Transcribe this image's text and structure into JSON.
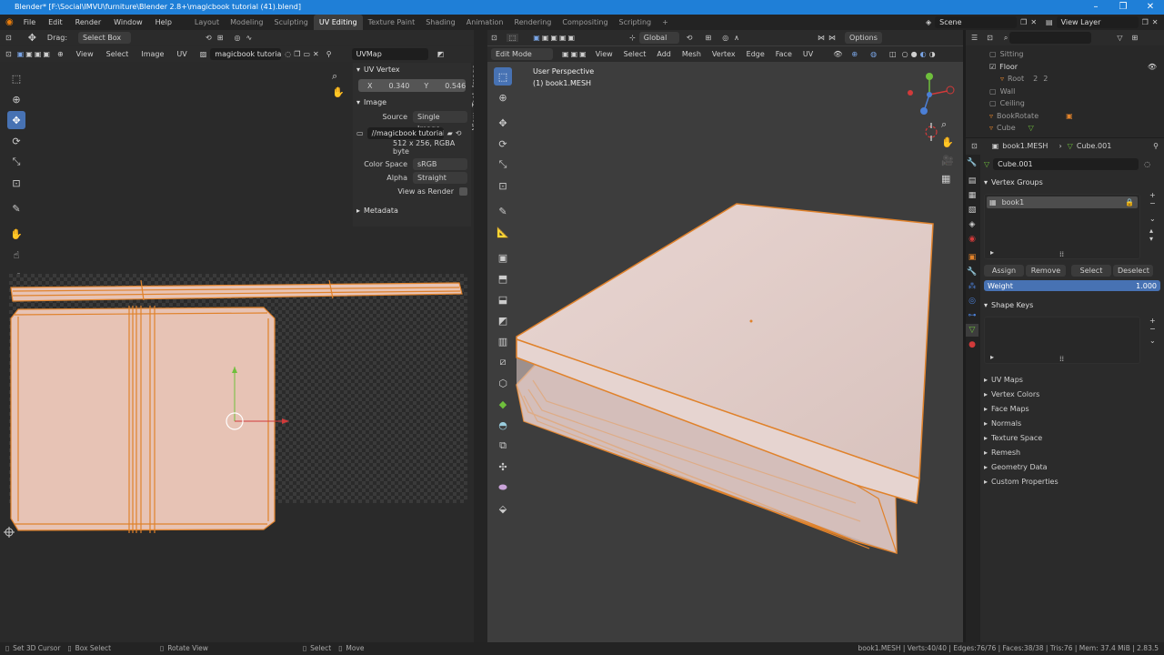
{
  "title": "Blender* [F:\\Social\\IMVU\\furniture\\Blender 2.8+\\magicbook tutorial (41).blend]",
  "window_controls": [
    "–",
    "❐",
    "✕"
  ],
  "menu": [
    "File",
    "Edit",
    "Render",
    "Window",
    "Help"
  ],
  "workspaces": [
    "Layout",
    "Modeling",
    "Sculpting",
    "UV Editing",
    "Texture Paint",
    "Shading",
    "Animation",
    "Rendering",
    "Compositing",
    "Scripting",
    "+"
  ],
  "scene": "Scene",
  "view_layer": "View Layer",
  "uv_editor": {
    "drag_label": "Drag:",
    "drag_value": "Select Box",
    "menus": [
      "View",
      "Select",
      "Image",
      "UV"
    ],
    "image_name": "magicbook tutorial (...",
    "uvmap": "UVMap",
    "npanel": {
      "uv_vertex": "UV Vertex",
      "x_label": "X",
      "x_value": "0.340",
      "y_label": "Y",
      "y_value": "0.546",
      "image": "Image",
      "source_label": "Source",
      "source_value": "Single Image",
      "filepath": "//magicbook tutorial ...",
      "info": "512 x 256,  RGBA byte",
      "colorspace_label": "Color Space",
      "colorspace_value": "sRGB",
      "alpha_label": "Alpha",
      "alpha_value": "Straight",
      "view_as_render": "View as Render",
      "metadata": "Metadata",
      "tabs": [
        "Image",
        "Tool",
        "View"
      ]
    }
  },
  "viewport": {
    "mode": "Edit Mode",
    "menus": [
      "View",
      "Select",
      "Add",
      "Mesh",
      "Vertex",
      "Edge",
      "Face",
      "UV"
    ],
    "orientation": "Global",
    "options": "Options",
    "perspective": "User Perspective",
    "object": "(1) book1.MESH"
  },
  "outliner": {
    "items": [
      "Sitting",
      "Floor",
      "Root",
      "Wall",
      "Ceiling",
      "BookRotate",
      "Cube"
    ],
    "root_badges": [
      "2",
      "2"
    ]
  },
  "properties": {
    "header_mesh": "book1.MESH",
    "header_obj": "Cube.001",
    "mesh_name": "Cube.001",
    "vertex_groups": "Vertex Groups",
    "group_item": "book1",
    "buttons": [
      "Assign",
      "Remove",
      "Select",
      "Deselect"
    ],
    "weight_label": "Weight",
    "weight_value": "1.000",
    "shape_keys": "Shape Keys",
    "subpanels": [
      "UV Maps",
      "Vertex Colors",
      "Face Maps",
      "Normals",
      "Texture Space",
      "Remesh",
      "Geometry Data",
      "Custom Properties"
    ]
  },
  "status": {
    "left": [
      "Set 3D Cursor",
      "Box Select",
      "Rotate View",
      "Select",
      "Move"
    ],
    "right": "book1.MESH | Verts:40/40 | Edges:76/76 | Faces:38/38 | Tris:76 | Mem: 37.4 MiB | 2.83.5"
  },
  "colors": {
    "accent": "#4772b3",
    "title": "#1f7fd7",
    "uv_face": "#e7c3b5",
    "edge": "#e0822b"
  }
}
